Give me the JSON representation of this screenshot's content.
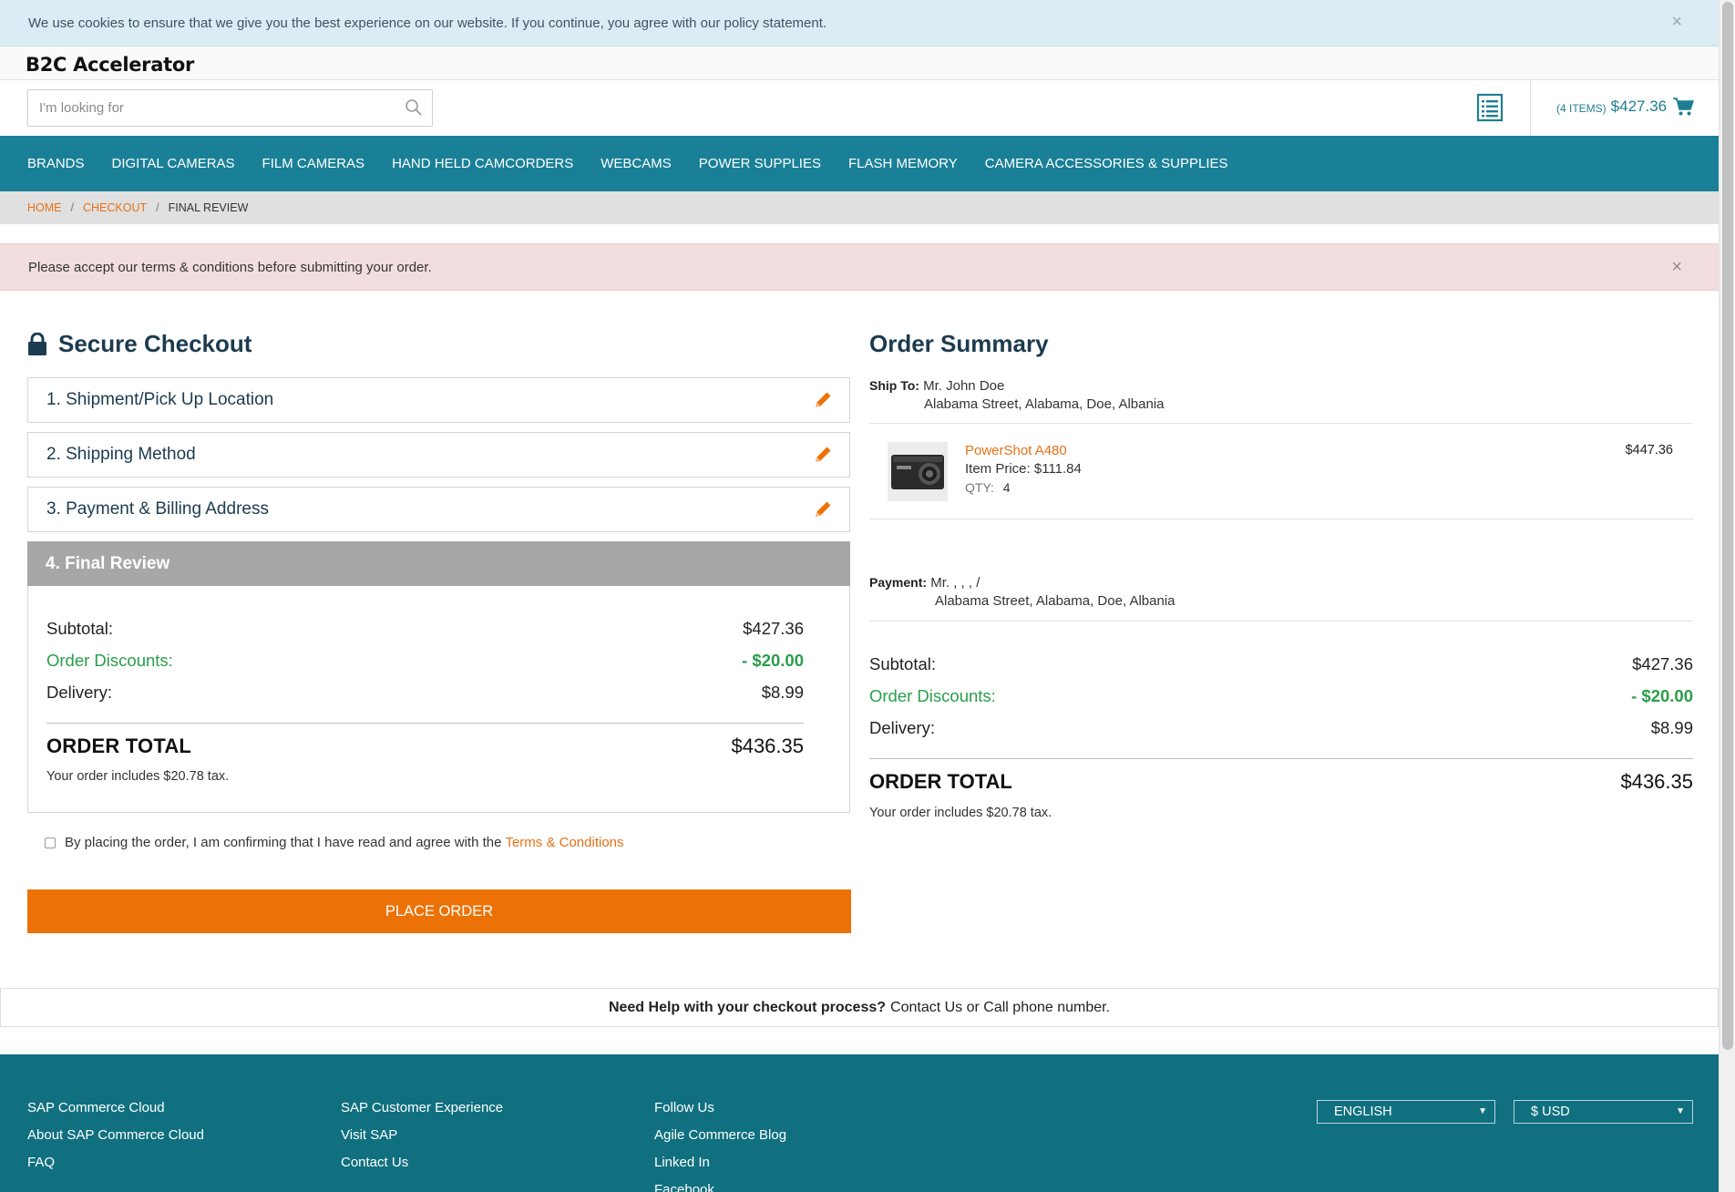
{
  "cookie_bar": {
    "message": "We use cookies to ensure that we give you the best experience on our website. If you continue, you agree with our policy statement.",
    "close_label": "×"
  },
  "header": {
    "brand": "B2C Accelerator",
    "search_placeholder": "I'm looking for",
    "cart_items": "(4 ITEMS)",
    "cart_total": "$427.36"
  },
  "nav": {
    "items": [
      "BRANDS",
      "DIGITAL CAMERAS",
      "FILM CAMERAS",
      "HAND HELD CAMCORDERS",
      "WEBCAMS",
      "POWER SUPPLIES",
      "FLASH MEMORY",
      "CAMERA ACCESSORIES & SUPPLIES"
    ]
  },
  "breadcrumb": {
    "home": "HOME",
    "separator": "/",
    "checkout": "CHECKOUT",
    "current": "FINAL REVIEW"
  },
  "alert": {
    "message": "Please accept our terms & conditions before submitting your order.",
    "close_label": "×"
  },
  "checkout": {
    "title": "Secure Checkout",
    "steps": [
      "1. Shipment/Pick Up Location",
      "2. Shipping Method",
      "3. Payment & Billing Address"
    ],
    "active_step": "4. Final Review",
    "totals": {
      "subtotal_label": "Subtotal:",
      "subtotal": "$427.36",
      "discount_label": "Order Discounts:",
      "discount": "- $20.00",
      "delivery_label": "Delivery:",
      "delivery": "$8.99",
      "order_total_label": "ORDER TOTAL",
      "order_total": "$436.35",
      "tax_note": "Your order includes $20.78 tax."
    },
    "terms_text": "By placing the order, I am confirming that I have read and agree with the",
    "terms_link": "Terms & Conditions",
    "terms_checked": false,
    "place_order": "PLACE ORDER"
  },
  "summary": {
    "title": "Order Summary",
    "ship_to_label": "Ship To:",
    "ship_to_name": "Mr. John Doe",
    "ship_to_address": "Alabama Street,  Alabama,  Doe,  Albania",
    "product": {
      "name": "PowerShot A480",
      "item_price_label": "Item Price:",
      "item_price": "$111.84",
      "qty_label": "QTY:",
      "qty": "4",
      "total": "$447.36"
    },
    "payment_label": "Payment:",
    "payment_name": "Mr. , , , /",
    "payment_address": "Alabama Street, Alabama,  Doe, Albania",
    "totals": {
      "subtotal_label": "Subtotal:",
      "subtotal": "$427.36",
      "discount_label": "Order Discounts:",
      "discount": "- $20.00",
      "delivery_label": "Delivery:",
      "delivery": "$8.99",
      "order_total_label": "ORDER TOTAL",
      "order_total": "$436.35",
      "tax_note": "Your order includes $20.78 tax."
    }
  },
  "help": {
    "question": "Need Help with your checkout process?",
    "answer": "Contact Us or Call phone number."
  },
  "footer": {
    "col1": [
      "SAP Commerce Cloud",
      "About SAP Commerce Cloud",
      "FAQ"
    ],
    "col2": [
      "SAP Customer Experience",
      "Visit SAP",
      "Contact Us"
    ],
    "col3": [
      "Follow Us",
      "Agile Commerce Blog",
      "Linked In",
      "Facebook"
    ],
    "language": "ENGLISH",
    "currency": "$ USD"
  },
  "colors": {
    "accent_orange": "#ec7207",
    "nav_teal": "#1a8097",
    "footer_teal": "#10707f",
    "discount_green": "#2a9d4b"
  }
}
